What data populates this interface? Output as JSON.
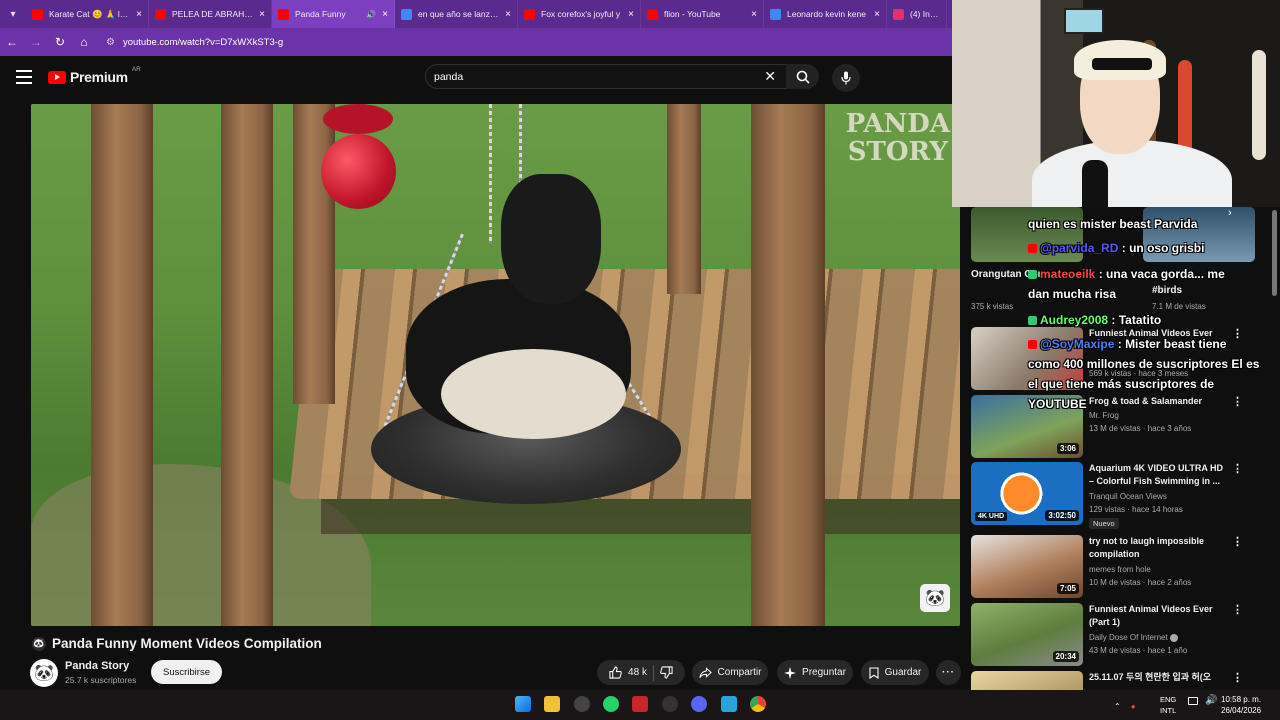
{
  "browser": {
    "tabs": [
      {
        "title": "Karate Cat 😊 🙏 l ca",
        "favicon": "#ff0000"
      },
      {
        "title": "PELEA DE ABRAHAM",
        "favicon": "#ff0000"
      },
      {
        "title": "Panda Funny",
        "favicon": "#ff0000",
        "active": true
      },
      {
        "title": "en que año se lanzo y",
        "favicon": "#4285f4"
      },
      {
        "title": "Fox corefox's joyful y",
        "favicon": "#ff0000"
      },
      {
        "title": "flion - YouTube",
        "favicon": "#ff0000"
      },
      {
        "title": "Leonardo kevin kene",
        "favicon": "#4285f4"
      },
      {
        "title": "(4) Instagram",
        "favicon": "#e1306c"
      }
    ],
    "url": "youtube.com/watch?v=D7xWXkST3-g"
  },
  "youtube": {
    "logo_text": "Premium",
    "region": "AR",
    "search_value": "panda"
  },
  "video": {
    "watermark_line1": "PANDA",
    "watermark_line2": "STORY",
    "title": "Panda Funny Moment Videos Compilation",
    "channel": "Panda Story",
    "subscribers": "25.7 k suscriptores",
    "subscribe_label": "Suscribirse",
    "likes": "48 k",
    "share_label": "Compartir",
    "ask_label": "Preguntar",
    "save_label": "Guardar"
  },
  "sidebar": {
    "top_partial": [
      {
        "title": "Orangutan Core ...",
        "meta": "375 k vistas"
      },
      {
        "title": "#birds",
        "meta": "7.1 M de vistas"
      }
    ],
    "cards": [
      {
        "title": "Funniest Animal Videos Ever",
        "channel": "",
        "meta": "569 k vistas · hace 3 meses",
        "duration": ""
      },
      {
        "title": "Frog & toad & Salamander",
        "channel": "Mr. Frog",
        "meta": "13 M de vistas · hace 3 años",
        "duration": "3:06"
      },
      {
        "title": "Aquarium 4K VIDEO ULTRA HD – Colorful Fish Swimming in ...",
        "channel": "Tranquil Ocean Views",
        "meta": "129 vistas · hace 14 horas",
        "duration": "3:02:50",
        "badge": "Nuevo",
        "uhd": "4K UHD"
      },
      {
        "title": "try not to laugh impossible compilation",
        "channel": "memes from hole",
        "meta": "10 M de vistas · hace 2 años",
        "duration": "7:05"
      },
      {
        "title": "Funniest Animal Videos Ever (Part 1)",
        "channel": "Daily Dose Of Internet",
        "meta": "43 M de vistas · hace 1 año",
        "duration": "20:34"
      },
      {
        "title": "25.11.07 두의 현란한 입과 허(오",
        "channel": "",
        "meta": "",
        "duration": ""
      }
    ]
  },
  "chat": [
    {
      "user": "",
      "text": "quien es mister beast Parvida",
      "color": "#ffffff"
    },
    {
      "user": "@parvida_RD",
      "text": ": un oso grisbi",
      "color": "#5555ff"
    },
    {
      "user": "mateoeilk",
      "text": ": una vaca gorda... me",
      "color": "#ff4444"
    },
    {
      "user": "",
      "text": "dan mucha risa",
      "color": "#ffffff"
    },
    {
      "user": "Audrey2008",
      "text": ": Tatatito",
      "color": "#66ff66"
    },
    {
      "user": "@SoyMaxipe",
      "text": ": Mister beast tiene",
      "color": "#4d7cff"
    },
    {
      "user": "",
      "text": "como 400 millones de suscriptores El es",
      "color": "#ffffff"
    },
    {
      "user": "",
      "text": "el que tiene más suscriptores de",
      "color": "#ffffff"
    },
    {
      "user": "",
      "text": "YOUTUBE",
      "color": "#ffffff"
    }
  ],
  "taskbar": {
    "lang1": "ENG",
    "lang2": "INTL",
    "time": "10:58 p. m.",
    "date": "26/04/2026"
  }
}
